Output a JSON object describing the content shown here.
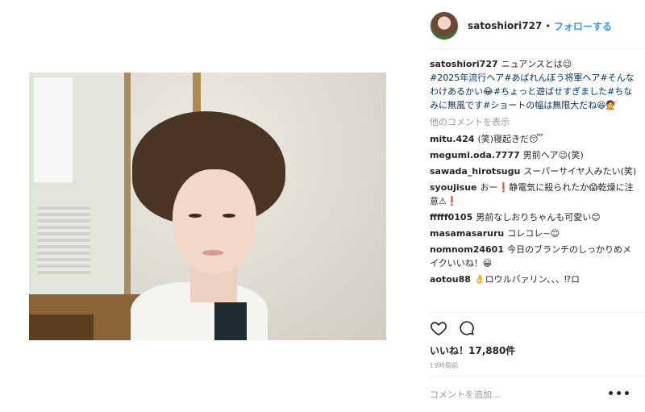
{
  "post": {
    "username": "satoshiori727",
    "follow_label": "フォローする",
    "separator": "•",
    "caption": {
      "username": "satoshiori727",
      "lead": "ニュアンスとは😉",
      "hashtags": "#2025年流行ヘア#あばれんぼう将軍ヘア#そんなわけあるかい😂#ちょっと遊ばせすぎました#ちなみに無風です#ショートの幅は無限大だね😆💇"
    },
    "view_more_label": "他のコメントを表示",
    "comments": [
      {
        "user": "mitu.424",
        "text": "(笑)寝起きだ😴"
      },
      {
        "user": "megumi.oda.7777",
        "text": "男前ヘア😉(笑)"
      },
      {
        "user": "sawada_hirotsugu",
        "text": "スーパーサイヤ人みたい(笑)"
      },
      {
        "user": "syoujisue",
        "text": "おー❗静電気に殺られたか😱乾燥に注意⚠❗"
      },
      {
        "user": "fffff0105",
        "text": "男前なしおりちゃんも可愛い😊"
      },
      {
        "user": "masamasaruru",
        "text": "コレコレ~😊"
      },
      {
        "user": "nomnom24601",
        "text": "今日のブランチのしっかりめメイクいいね！😀"
      },
      {
        "user": "aotou88",
        "text": "👌ロウルバァリン、、、⁉ロ"
      }
    ],
    "likes_label": "いいね！17,880件",
    "time_label": "19時間前",
    "add_comment_placeholder": "コメントを追加...",
    "options_label": "•••"
  },
  "icons": {
    "like": "heart-icon",
    "comment": "comment-bubble-icon"
  }
}
